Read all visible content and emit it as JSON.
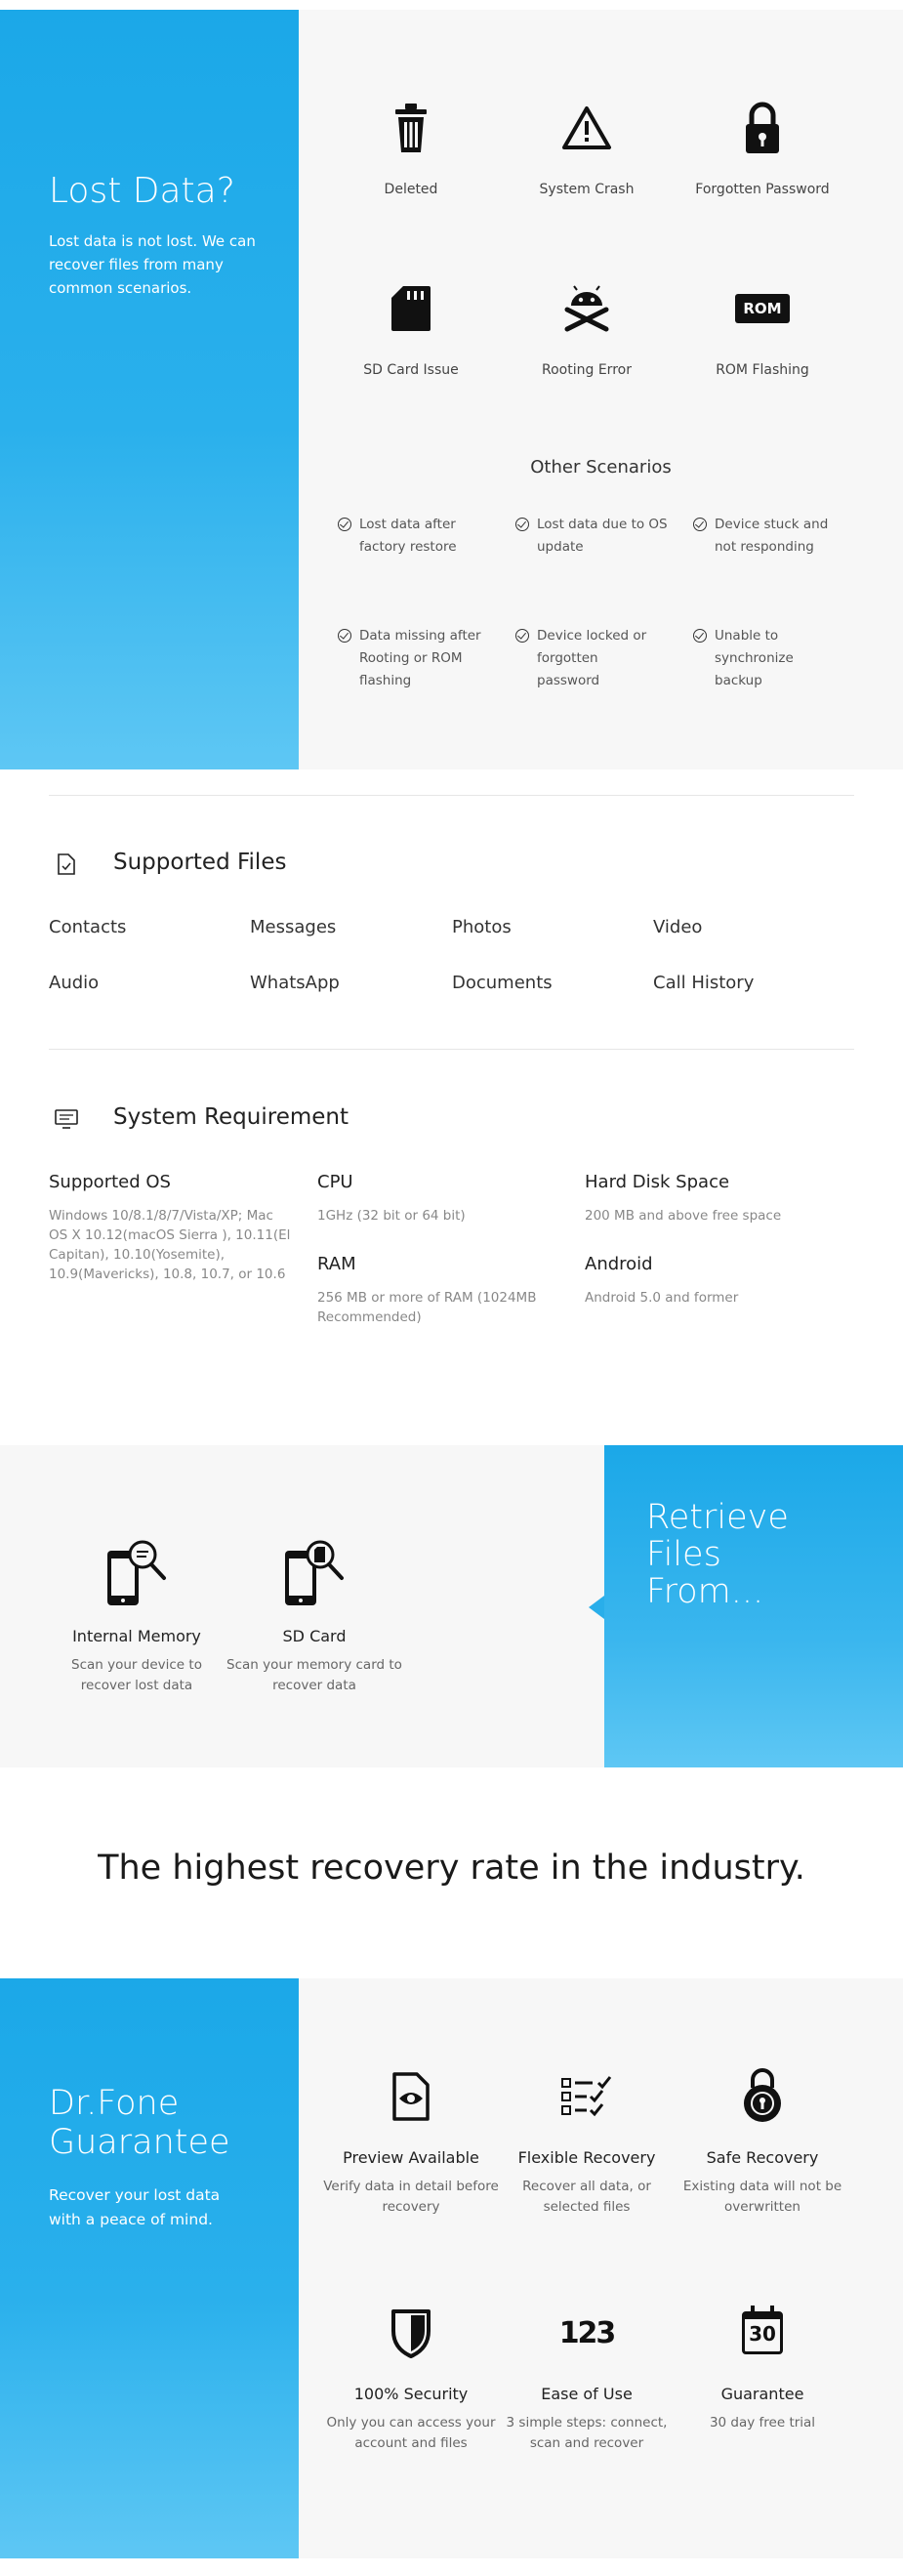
{
  "lost_data": {
    "title": "Lost Data?",
    "description": "Lost data is not lost. We can recover files from many common scenarios.",
    "scenarios": [
      {
        "label": "Deleted",
        "icon": "trash-icon"
      },
      {
        "label": "System Crash",
        "icon": "warning-icon"
      },
      {
        "label": "Forgotten Password",
        "icon": "lock-icon"
      },
      {
        "label": "SD Card Issue",
        "icon": "sd-card-icon"
      },
      {
        "label": "Rooting Error",
        "icon": "android-crossbones-icon"
      },
      {
        "label": "ROM Flashing",
        "icon": "rom-chip-icon"
      }
    ],
    "rom_chip_text": "ROM",
    "other_title": "Other Scenarios",
    "other": [
      "Lost data after factory restore",
      "Lost data due to OS update",
      "Device stuck and not responding",
      "Data missing after Rooting or ROM flashing",
      "Device locked or forgotten password",
      "Unable to synchronize backup"
    ]
  },
  "supported_files": {
    "title": "Supported Files",
    "items": [
      "Contacts",
      "Messages",
      "Photos",
      "Video",
      "Audio",
      "WhatsApp",
      "Documents",
      "Call History"
    ]
  },
  "system_requirement": {
    "title": "System Requirement",
    "os_title": "Supported OS",
    "os_value": "Windows 10/8.1/8/7/Vista/XP; Mac OS X 10.12(macOS Sierra ), 10.11(El Capitan), 10.10(Yosemite), 10.9(Mavericks), 10.8, 10.7, or 10.6",
    "cpu_title": "CPU",
    "cpu_value": "1GHz (32 bit or 64 bit)",
    "ram_title": "RAM",
    "ram_value": "256 MB or more of RAM (1024MB Recommended)",
    "disk_title": "Hard Disk Space",
    "disk_value": "200 MB and above free space",
    "android_title": "Android",
    "android_value": "Android 5.0 and former"
  },
  "retrieve": {
    "title": "Retrieve Files From...",
    "items": [
      {
        "label": "Internal Memory",
        "sub": "Scan your device to recover lost data",
        "icon": "phone-search-icon"
      },
      {
        "label": "SD Card",
        "sub": "Scan your memory card to recover data",
        "icon": "phone-sd-search-icon"
      }
    ]
  },
  "slogan": "The highest recovery rate in the industry.",
  "guarantee": {
    "title": "Dr.Fone Guarantee",
    "description": "Recover your lost data with a peace of mind.",
    "items": [
      {
        "label": "Preview Available",
        "sub": "Verify data in detail before recovery",
        "icon": "preview-file-icon"
      },
      {
        "label": "Flexible Recovery",
        "sub": "Recover all data, or selected files",
        "icon": "checklist-icon"
      },
      {
        "label": "Safe Recovery",
        "sub": "Existing data will not be overwritten",
        "icon": "safe-lock-icon"
      },
      {
        "label": "100% Security",
        "sub": "Only you can access your account and files",
        "icon": "shield-icon"
      },
      {
        "label": "Ease of Use",
        "sub": "3 simple steps: connect, scan and recover",
        "icon": "one-two-three-icon"
      },
      {
        "label": "Guarantee",
        "sub": "30 day free trial",
        "icon": "calendar-30-icon"
      }
    ],
    "steps_text": "123",
    "calendar_text": "30"
  },
  "colors": {
    "accent_blue": "#1ba8e8",
    "panel_gray": "#f7f7f7"
  }
}
